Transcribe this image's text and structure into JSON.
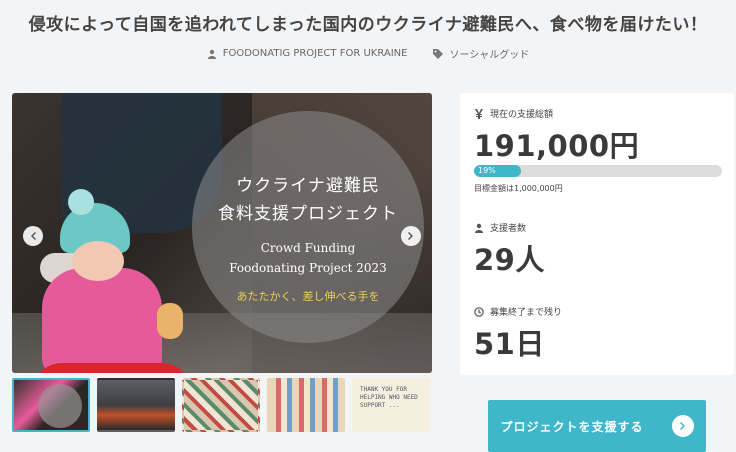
{
  "page": {
    "title": "侵攻によって自国を追われてしまった国内のウクライナ避難民へ、食べ物を届けたい！"
  },
  "meta": {
    "owner": "FOODONATIG PROJECT FOR UKRAINE",
    "owner_icon": "person-icon",
    "category": "ソーシャルグッド",
    "category_icon": "tag-icon"
  },
  "hero": {
    "overlay_line1": "ウクライナ避難民",
    "overlay_line2": "食料支援プロジェクト",
    "overlay_line3": "Crowd Funding",
    "overlay_line4": "Foodonating Project 2023",
    "overlay_line5": "あたたかく、差し伸べる手を"
  },
  "thumbnails": [
    {
      "alt": "",
      "active": true
    },
    {
      "alt": "",
      "active": false
    },
    {
      "alt": "",
      "active": false
    },
    {
      "alt": "",
      "active": false
    },
    {
      "alt": "",
      "active": false
    }
  ],
  "thumb5_text": "THANK YOU FOR HELPING WHO NEED SUPPORT ...",
  "stats": {
    "total_label": "現在の支援総額",
    "total_value": "191,000円",
    "progress_percent": 19,
    "progress_label": "19%",
    "goal_text": "目標金額は1,000,000円",
    "backers_label": "支援者数",
    "backers_value": "29人",
    "remaining_label": "募集終了まで残り",
    "remaining_value": "51日"
  },
  "cta": {
    "label": "プロジェクトを支援する"
  },
  "colors": {
    "accent": "#3fb6c9",
    "background": "#f3f4f6"
  }
}
